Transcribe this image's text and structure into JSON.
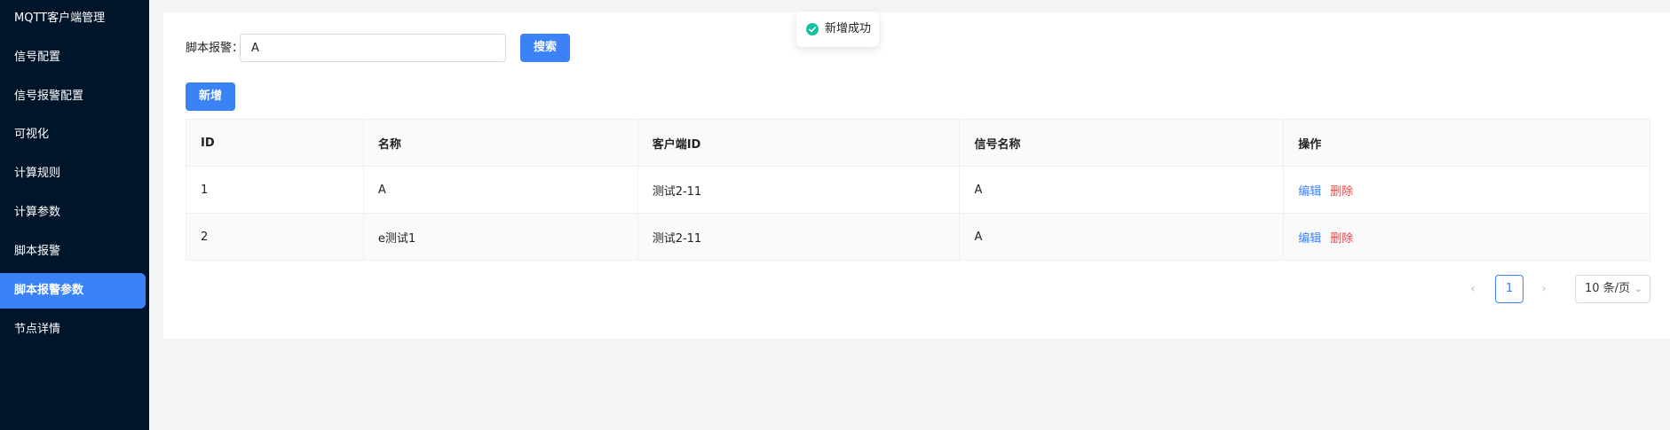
{
  "sidebar": {
    "items": [
      {
        "label": "MQTT客户端管理"
      },
      {
        "label": "信号配置"
      },
      {
        "label": "信号报警配置"
      },
      {
        "label": "可视化"
      },
      {
        "label": "计算规则"
      },
      {
        "label": "计算参数"
      },
      {
        "label": "脚本报警"
      },
      {
        "label": "脚本报警参数",
        "active": true
      },
      {
        "label": "节点详情"
      }
    ]
  },
  "search": {
    "label": "脚本报警：",
    "value": "A",
    "button_label": "搜索"
  },
  "toolbar": {
    "add_label": "新增"
  },
  "table": {
    "columns": [
      "ID",
      "名称",
      "客户端ID",
      "信号名称",
      "操作"
    ],
    "rows": [
      {
        "id": "1",
        "name": "A",
        "client_id": "测试2-11",
        "signal_name": "A"
      },
      {
        "id": "2",
        "name": "e测试1",
        "client_id": "测试2-11",
        "signal_name": "A"
      }
    ],
    "edit_label": "编辑",
    "delete_label": "删除"
  },
  "pagination": {
    "prev_icon": "chevron-left-icon",
    "current_page": "1",
    "next_icon": "chevron-right-icon",
    "page_size": "10 条/页"
  },
  "toast": {
    "message": "新增成功",
    "icon": "check-circle-icon",
    "color": "#13c2a0"
  },
  "colors": {
    "sidebar_bg": "#001529",
    "primary": "#3b82f6",
    "danger": "#ef4444"
  }
}
